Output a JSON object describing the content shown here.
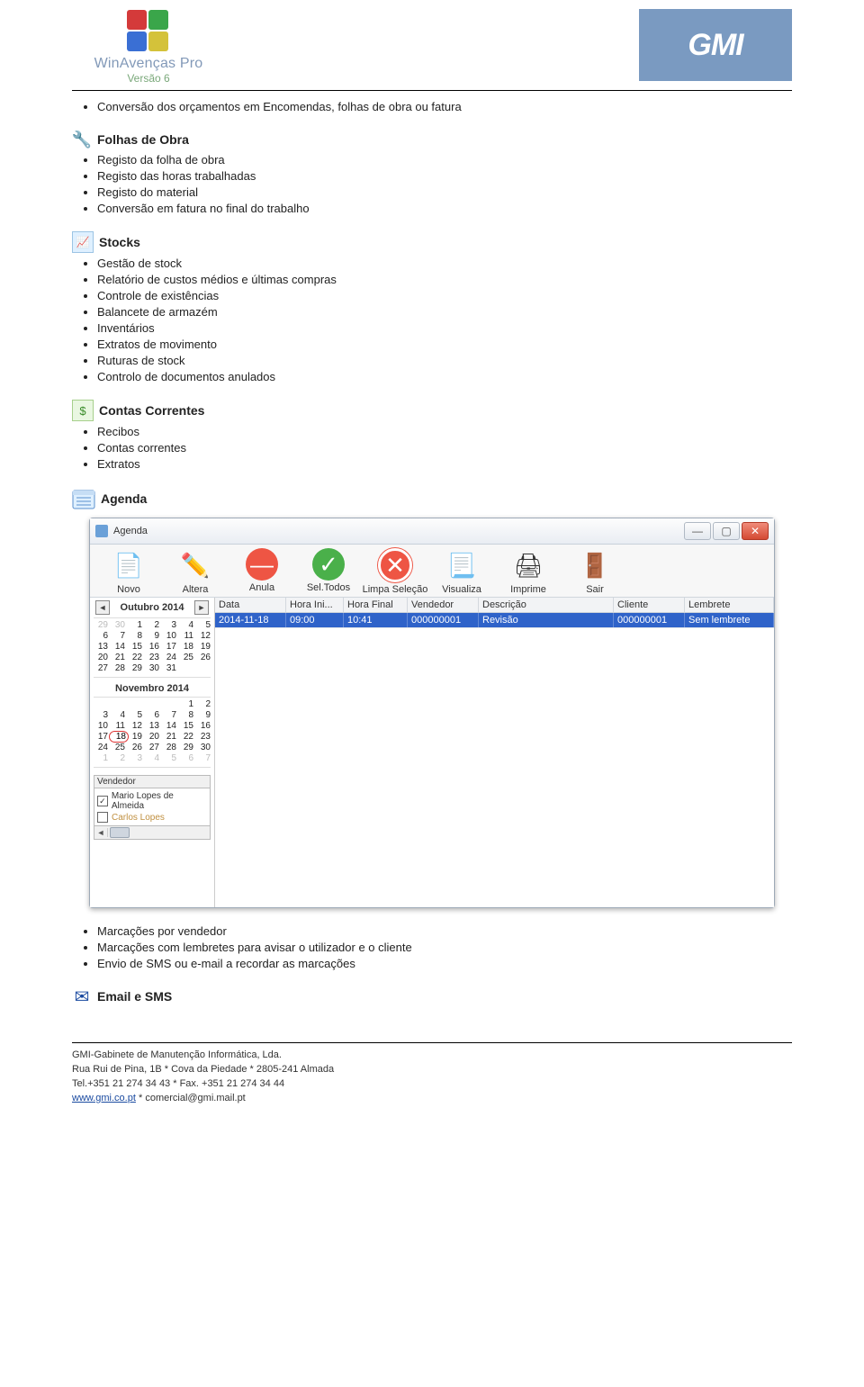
{
  "header": {
    "product_title": "WinAvenças Pro",
    "product_sub": "Versão 6",
    "brand": "GMI"
  },
  "top_bullet": "Conversão dos orçamentos em Encomendas, folhas de obra ou fatura",
  "sections": {
    "folhas": {
      "title": "Folhas de Obra",
      "items": [
        "Registo da folha de obra",
        "Registo das horas trabalhadas",
        "Registo do material",
        "Conversão em fatura no final do trabalho"
      ]
    },
    "stocks": {
      "title": "Stocks",
      "items": [
        "Gestão de stock",
        "Relatório de custos médios e últimas compras",
        "Controle de existências",
        "Balancete de armazém",
        "Inventários",
        "Extratos de movimento",
        "Ruturas de stock",
        "Controlo de documentos anulados"
      ]
    },
    "contas": {
      "title": "Contas Correntes",
      "items": [
        "Recibos",
        "Contas correntes",
        "Extratos"
      ]
    },
    "agenda": {
      "title": "Agenda"
    },
    "agenda_after": {
      "items": [
        "Marcações por vendedor",
        "Marcações com lembretes para avisar o utilizador e o cliente",
        "Envio de SMS ou e-mail a recordar as marcações"
      ]
    },
    "email": {
      "title": "Email e SMS"
    }
  },
  "agenda_window": {
    "title": "Agenda",
    "toolbar": {
      "novo": "Novo",
      "altera": "Altera",
      "anula": "Anula",
      "sel": "Sel.Todos",
      "limpa": "Limpa Seleção",
      "visualiza": "Visualiza",
      "imprime": "Imprime",
      "sair": "Sair"
    },
    "month1": "Outubro 2014",
    "month2": "Novembro 2014",
    "calendar1": [
      [
        "29",
        "30",
        "1",
        "2",
        "3",
        "4",
        "5"
      ],
      [
        "6",
        "7",
        "8",
        "9",
        "10",
        "11",
        "12"
      ],
      [
        "13",
        "14",
        "15",
        "16",
        "17",
        "18",
        "19"
      ],
      [
        "20",
        "21",
        "22",
        "23",
        "24",
        "25",
        "26"
      ],
      [
        "27",
        "28",
        "29",
        "30",
        "31",
        "",
        ""
      ]
    ],
    "calendar2": [
      [
        "",
        "",
        "",
        "",
        "",
        "1",
        "2"
      ],
      [
        "3",
        "4",
        "5",
        "6",
        "7",
        "8",
        "9"
      ],
      [
        "10",
        "11",
        "12",
        "13",
        "14",
        "15",
        "16"
      ],
      [
        "17",
        "18",
        "19",
        "20",
        "21",
        "22",
        "23"
      ],
      [
        "24",
        "25",
        "26",
        "27",
        "28",
        "29",
        "30"
      ],
      [
        "1",
        "2",
        "3",
        "4",
        "5",
        "6",
        "7"
      ]
    ],
    "vend_label": "Vendedor",
    "vendors": [
      {
        "name": "Mario Lopes de Almeida",
        "checked": true
      },
      {
        "name": "Carlos Lopes",
        "checked": false
      }
    ],
    "columns": {
      "data": "Data",
      "hora_ini": "Hora Ini...",
      "hora_final": "Hora Final",
      "vendedor": "Vendedor",
      "descricao": "Descrição",
      "cliente": "Cliente",
      "lembrete": "Lembrete"
    },
    "row": {
      "data": "2014-11-18",
      "hora_ini": "09:00",
      "hora_final": "10:41",
      "vendedor": "000000001",
      "descricao": "Revisão",
      "cliente": "000000001",
      "lembrete": "Sem lembrete"
    }
  },
  "footer": {
    "l1": "GMI-Gabinete de Manutenção Informática, Lda.",
    "l2": "Rua Rui de Pina, 1B * Cova da Piedade * 2805-241 Almada",
    "l3": "Tel.+351 21 274 34 43 * Fax. +351 21 274 34 44",
    "site": "www.gmi.co.pt",
    "email_sep": " * ",
    "email": "comercial@gmi.mail.pt"
  }
}
